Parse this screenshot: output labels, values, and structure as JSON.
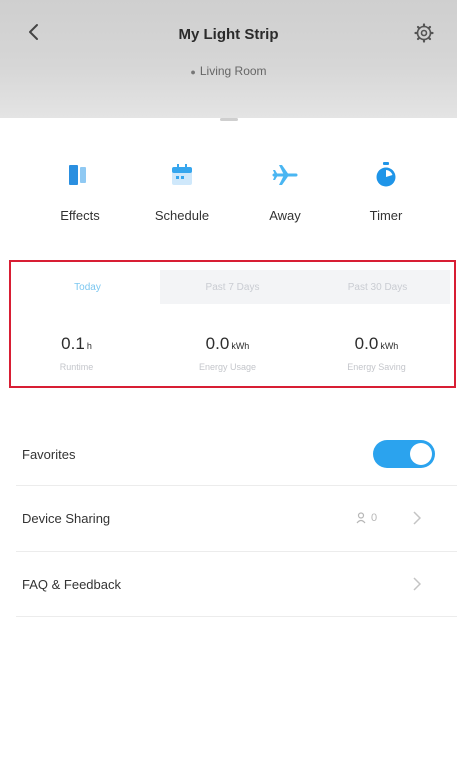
{
  "header": {
    "title": "My Light Strip",
    "room": "Living Room"
  },
  "functions": [
    {
      "label": "Effects",
      "icon": "effects-icon"
    },
    {
      "label": "Schedule",
      "icon": "calendar-icon"
    },
    {
      "label": "Away",
      "icon": "airplane-icon"
    },
    {
      "label": "Timer",
      "icon": "timer-icon"
    }
  ],
  "stats": {
    "tabs": [
      "Today",
      "Past 7 Days",
      "Past 30 Days"
    ],
    "active_tab": "Today",
    "items": [
      {
        "value": "0.1",
        "unit": "h",
        "caption": "Runtime"
      },
      {
        "value": "0.0",
        "unit": "kWh",
        "caption": "Energy Usage"
      },
      {
        "value": "0.0",
        "unit": "kWh",
        "caption": "Energy Saving"
      }
    ]
  },
  "list": {
    "favorites": {
      "label": "Favorites",
      "on": true
    },
    "sharing": {
      "label": "Device Sharing",
      "count": "0"
    },
    "faq": {
      "label": "FAQ & Feedback"
    }
  },
  "colors": {
    "accent": "#2ba3ee",
    "highlight_border": "#d81e34",
    "effects": "#2a8fe0",
    "schedule": "#36a6ee",
    "away": "#4ab6f2",
    "timer": "#1f95e8"
  }
}
